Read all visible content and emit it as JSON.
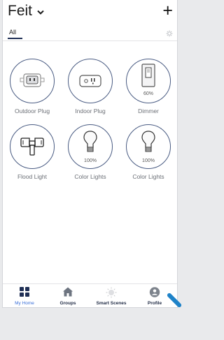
{
  "header": {
    "home_name": "Feit",
    "add_label": "+"
  },
  "filter": {
    "active_tab": "All"
  },
  "devices": [
    {
      "label": "Outdoor Plug",
      "icon": "outdoor-plug-icon"
    },
    {
      "label": "Indoor Plug",
      "icon": "indoor-plug-icon"
    },
    {
      "label": "Dimmer",
      "icon": "dimmer-icon",
      "level": "60%"
    },
    {
      "label": "Flood Light",
      "icon": "flood-light-icon"
    },
    {
      "label": "Color Lights",
      "icon": "bulb-icon",
      "level": "100%"
    },
    {
      "label": "Color Lights",
      "icon": "bulb-icon",
      "level": "100%"
    }
  ],
  "tabbar": {
    "items": [
      {
        "label": "My Home",
        "icon": "grid-icon",
        "active": true
      },
      {
        "label": "Groups",
        "icon": "house-icon",
        "active": false
      },
      {
        "label": "Smart Scenes",
        "icon": "sun-icon",
        "active": false
      },
      {
        "label": "Profile",
        "icon": "person-icon",
        "active": false
      }
    ]
  },
  "colors": {
    "accent": "#3a6fd8",
    "circle_border": "#4a5c83",
    "text_dark": "#1f2a44",
    "label_gray": "#6b6f76"
  }
}
